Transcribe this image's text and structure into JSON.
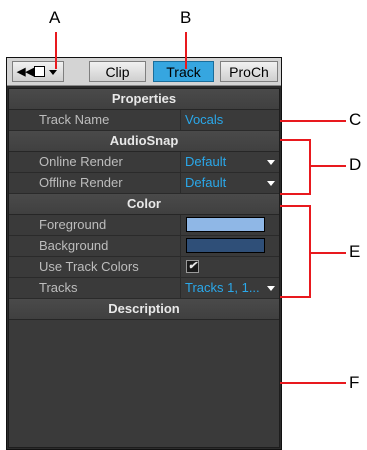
{
  "callouts": {
    "a": "A",
    "b": "B",
    "c": "C",
    "d": "D",
    "e": "E",
    "f": "F"
  },
  "tabs": {
    "clip": "Clip",
    "track": "Track",
    "proch": "ProCh"
  },
  "sections": {
    "properties": "Properties",
    "audiosnap": "AudioSnap",
    "color": "Color",
    "description": "Description"
  },
  "rows": {
    "track_name": {
      "label": "Track Name",
      "value": "Vocals"
    },
    "online_render": {
      "label": "Online Render",
      "value": "Default"
    },
    "offline_render": {
      "label": "Offline Render",
      "value": "Default"
    },
    "foreground": {
      "label": "Foreground",
      "color": "#8fb7e6"
    },
    "background": {
      "label": "Background",
      "color": "#2f4f78"
    },
    "use_track_colors": {
      "label": "Use Track Colors",
      "checked": true,
      "mark": "✔"
    },
    "tracks": {
      "label": "Tracks",
      "value": "Tracks 1, 1..."
    }
  },
  "colors": {
    "accent": "#36a6e0",
    "value_text": "#2aa8ea",
    "callout_line": "#e8191e"
  }
}
